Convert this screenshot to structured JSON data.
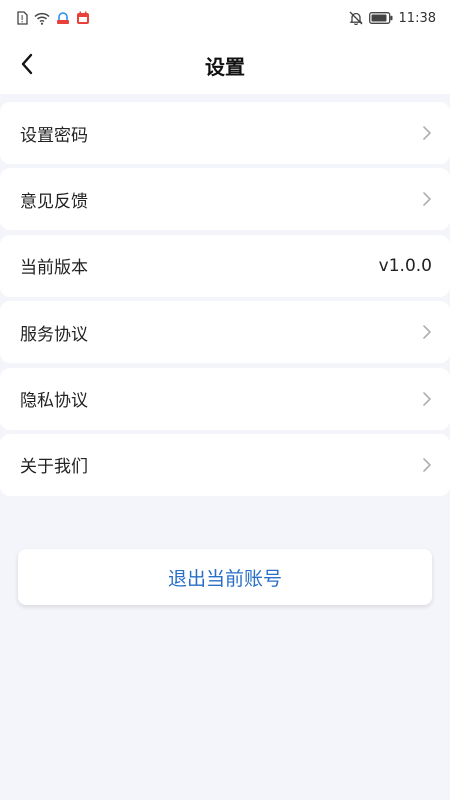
{
  "status_bar": {
    "time": "11:38",
    "icons_left": [
      "sim-alert-icon",
      "wifi-icon",
      "app-notification-icon",
      "calendar-icon"
    ],
    "icons_right": [
      "bell-muted-icon",
      "battery-icon"
    ]
  },
  "header": {
    "title": "设置",
    "back_icon": "chevron-left-icon"
  },
  "settings": {
    "items": [
      {
        "label": "设置密码",
        "value": "",
        "chevron": true
      },
      {
        "label": "意见反馈",
        "value": "",
        "chevron": true
      },
      {
        "label": "当前版本",
        "value": "v1.0.0",
        "chevron": false
      },
      {
        "label": "服务协议",
        "value": "",
        "chevron": true
      },
      {
        "label": "隐私协议",
        "value": "",
        "chevron": true
      },
      {
        "label": "关于我们",
        "value": "",
        "chevron": true
      }
    ]
  },
  "logout": {
    "label": "退出当前账号"
  },
  "colors": {
    "background": "#f4f5fa",
    "card": "#ffffff",
    "accent": "#2a6fc7",
    "chevron": "#b0b0b0"
  }
}
